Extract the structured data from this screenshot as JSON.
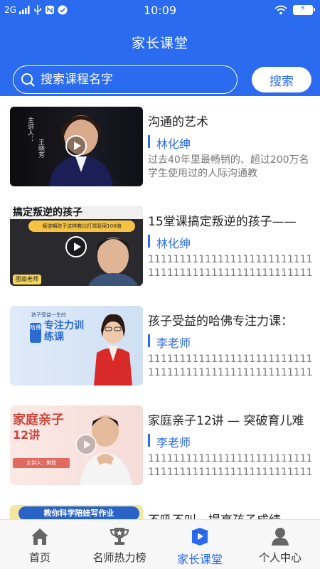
{
  "status_bar": {
    "network": "2G",
    "time": "10:09",
    "battery": "⚡"
  },
  "header": {
    "title": "家长课堂"
  },
  "search": {
    "placeholder": "搜索课程名字",
    "button_label": "搜索"
  },
  "courses": [
    {
      "title": "沟通的艺术",
      "teacher": "林化绅",
      "description": "过去40年里最畅销的、超过200万名学生使用过的人际沟通教",
      "thumb_text": [
        "主讲人：",
        "王晓芳"
      ]
    },
    {
      "title": "15堂课搞定叛逆的孩子——",
      "teacher": "林化绅",
      "description": "1111111111111111111111111111111111111111111111111111111111",
      "thumb_text": [
        "搞定叛逆的孩子",
        "叛逆期孩子这样教比打骂管用100倍",
        "图南老师"
      ]
    },
    {
      "title": "孩子受益的哈佛专注力课：",
      "teacher": "李老师",
      "description": "1111111111111111111111111111111111111111111111111111111111",
      "thumb_text": [
        "孩子受益一生的",
        "哈佛",
        "专注力训练课"
      ]
    },
    {
      "title": "家庭亲子12讲 — 突破育儿难",
      "teacher": "李老师",
      "description": "1111111111111111111111111111111111111111111111111111111111",
      "thumb_text": [
        "家庭亲子",
        "12讲",
        "主讲人：樊登"
      ]
    },
    {
      "title": "不吼不叫，提高孩子成绩",
      "teacher": "",
      "description": "",
      "thumb_text": [
        "教你科学陪娃写作业"
      ]
    }
  ],
  "tabs": [
    {
      "label": "首页",
      "icon": "home-icon",
      "active": false
    },
    {
      "label": "名师热力榜",
      "icon": "trophy-icon",
      "active": false
    },
    {
      "label": "家长课堂",
      "icon": "play-book-icon",
      "active": true
    },
    {
      "label": "个人中心",
      "icon": "person-icon",
      "active": false
    }
  ],
  "colors": {
    "brand": "#2B6BEF",
    "active_tab": "#2B6BEF",
    "inactive_icon": "#666666"
  }
}
